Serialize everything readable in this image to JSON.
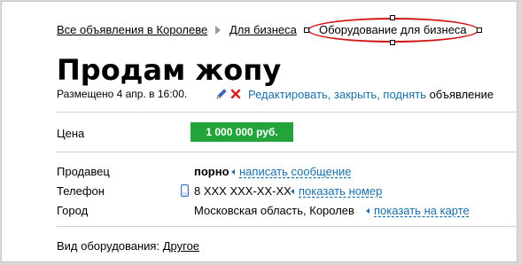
{
  "breadcrumbs": [
    "Все объявления в Королеве",
    "Для бизнеса",
    "Оборудование для бизнеса"
  ],
  "title": "Продам жопу",
  "posted": "Размещено 4 апр. в 16:00.",
  "actions": {
    "link": "Редактировать, закрыть, поднять",
    "suffix": "объявление"
  },
  "price": {
    "label": "Цена",
    "value": "1 000 000 руб."
  },
  "seller": {
    "label": "Продавец",
    "name": "порно",
    "action": "написать сообщение"
  },
  "phone": {
    "label": "Телефон",
    "value": "8 XXX XXX-XX-XX",
    "action": "показать номер"
  },
  "city": {
    "label": "Город",
    "value": "Московская область, Королев",
    "action": "показать на карте"
  },
  "equipment": {
    "label": "Вид оборудования:",
    "value": "Другое"
  },
  "colors": {
    "price_bg": "#22a43b",
    "link": "#1b6fa8",
    "annotation": "#d01414"
  }
}
